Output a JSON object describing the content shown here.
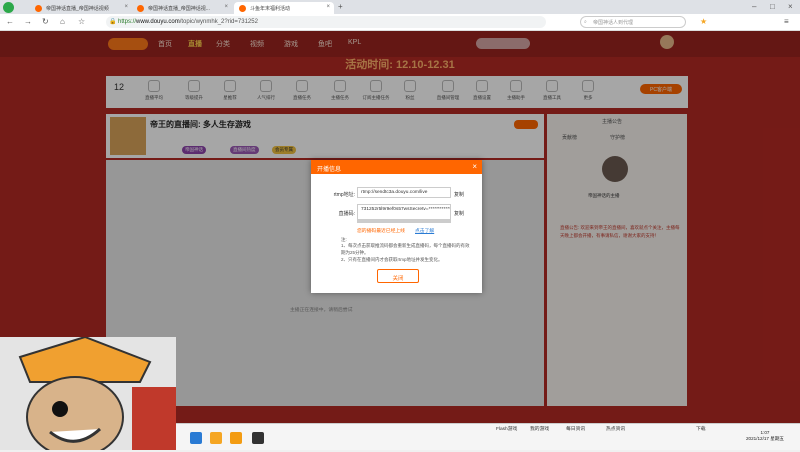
{
  "browser": {
    "tabs": [
      {
        "label": "帝国神话直播_帝国神话视频"
      },
      {
        "label": "帝国神话直播_帝国神话视..."
      },
      {
        "label": "斗鱼年末福利活动"
      }
    ],
    "url_scheme": "https://",
    "url_domain": "www.douyu.com",
    "url_path": "/topic/wynmhk_2?rid=731252",
    "search_placeholder": "帝国神话人到代理"
  },
  "site": {
    "nav": [
      "首页",
      "直播",
      "分类",
      "视频",
      "游戏",
      "鱼吧",
      "KPL"
    ],
    "nav_active_index": 1,
    "event_time": "活动时间: 12.10-12.31",
    "categories": [
      "直播时长",
      "直播平均",
      "等级提升",
      "星推荐",
      "人气排行",
      "直播任务",
      "主播任务",
      "订阅主播任务",
      "粉丝",
      "直播间管理",
      "直播设置",
      "主播助手",
      "直播工具",
      "更多"
    ],
    "top_count": "12",
    "pc_client": "PC客户端",
    "header_title": "帝王的直播间: 多人生存游戏",
    "header_badges": [
      "帝国神话",
      "直播间热度",
      "会员专属"
    ],
    "sidebar_tabs": [
      "主播公告",
      "贡献榜",
      "守护榜"
    ],
    "sidebar_name": "帝国神话的主播",
    "sidebar_notice": "直播公告: 欢迎来到帝王的直播间，喜欢就点个关注，主播每天晚上都会开播，有事请私信，谢谢大家的支持！"
  },
  "modal": {
    "title": "开播信息",
    "rtmp_label": "rtmp地址:",
    "rtmp_value": "rtmp://sendtc3a.douyu.com/live",
    "key_label": "直播码:",
    "key_value": "731252r5l9r9ef0s57wsSecretv=************",
    "copy_label": "复制",
    "warn_text": "您的播码最近已经上线",
    "warn_link": "点击了解",
    "notes": [
      "注:",
      "1、每次点击获取推流码都会重新生成直播码，每个直播码的有效期为25分钟。",
      "2、只有在直播间内才会获取rtmp地址并发生变化。"
    ],
    "ok_label": "关闭"
  },
  "player": {
    "tip": "主播正在连接中，请稍后尝试"
  },
  "taskbar": {
    "items": [
      "Flash游戏",
      "我的游戏",
      "每日资讯",
      "热点资讯"
    ],
    "extra": "下载",
    "time": "1:07",
    "date": "2021/12/17 星期五"
  },
  "colors": {
    "brand": "#ff6600",
    "site_bg": "#b32a24",
    "nav_bg": "#9a241f"
  }
}
